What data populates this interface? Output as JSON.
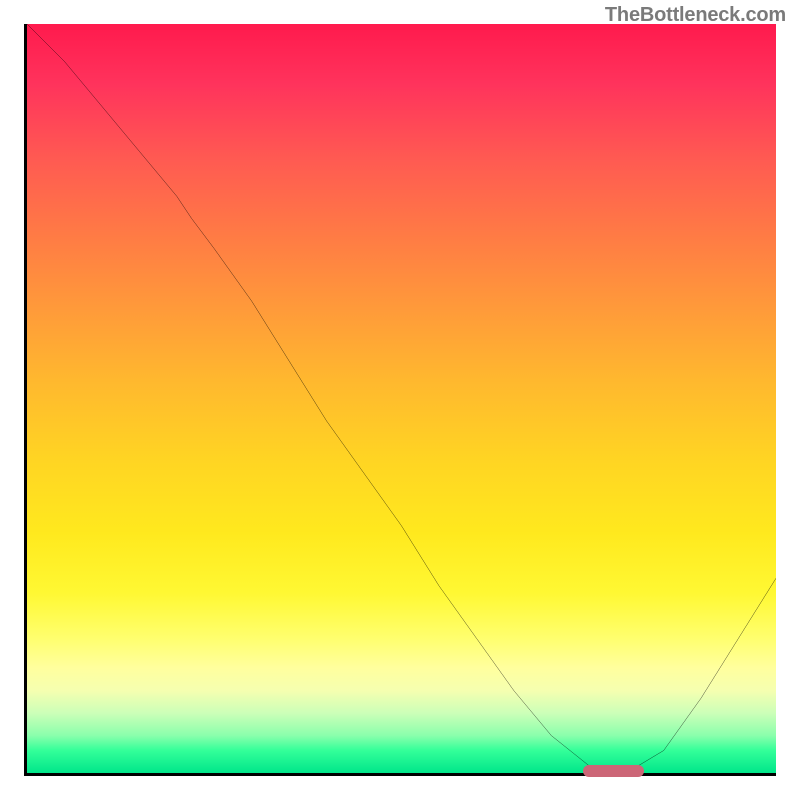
{
  "watermark": "TheBottleneck.com",
  "chart_data": {
    "type": "line",
    "title": "",
    "xlabel": "",
    "ylabel": "",
    "xlim": [
      0,
      100
    ],
    "ylim": [
      0,
      100
    ],
    "grid": false,
    "legend": null,
    "background_gradient": {
      "direction": "vertical",
      "stops": [
        {
          "pos": 0,
          "color": "#ff1a4d"
        },
        {
          "pos": 50,
          "color": "#ffc828"
        },
        {
          "pos": 82,
          "color": "#ffff9e"
        },
        {
          "pos": 100,
          "color": "#00e68a"
        }
      ],
      "meaning": "top=high bottleneck, bottom=low bottleneck"
    },
    "series": [
      {
        "name": "bottleneck-curve",
        "color": "#000000",
        "x": [
          0,
          5,
          10,
          15,
          20,
          22,
          25,
          30,
          35,
          40,
          45,
          50,
          55,
          60,
          65,
          70,
          75,
          78,
          80,
          85,
          90,
          95,
          100
        ],
        "y": [
          100,
          95,
          89,
          83,
          77,
          74,
          70,
          63,
          55,
          47,
          40,
          33,
          25,
          18,
          11,
          5,
          1,
          0,
          0,
          3,
          10,
          18,
          26
        ]
      }
    ],
    "annotations": [
      {
        "name": "optimal-marker",
        "shape": "rounded-bar",
        "color": "#cc6677",
        "x_range": [
          74,
          82
        ],
        "y": 0.3
      }
    ]
  }
}
